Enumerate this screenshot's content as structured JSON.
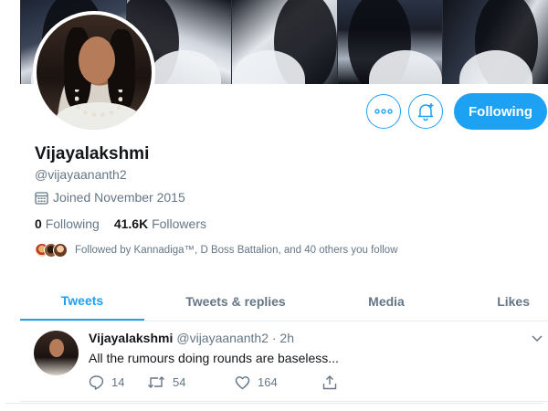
{
  "profile": {
    "name": "Vijayalakshmi",
    "handle": "@vijayaananth2",
    "joined": "Joined November 2015",
    "following_count": "0",
    "following_label": "Following",
    "followers_count": "41.6K",
    "followers_label": "Followers",
    "followed_by": "Followed by Kannadiga™, D Boss Battalion, and 40 others you follow"
  },
  "actions": {
    "follow_label": "Following",
    "more_icon": "more-icon",
    "notify_icon": "bell-plus-icon"
  },
  "tabs": [
    {
      "label": "Tweets",
      "active": true
    },
    {
      "label": "Tweets & replies",
      "active": false
    },
    {
      "label": "Media",
      "active": false
    },
    {
      "label": "Likes",
      "active": false
    }
  ],
  "tweet": {
    "name": "Vijayalakshmi",
    "meta": "@vijayaananth2 · 2h",
    "text": "All the rumours doing rounds are baseless...",
    "reply_count": "14",
    "retweet_count": "54",
    "like_count": "164"
  },
  "colors": {
    "accent": "#1da1f2",
    "text": "#14171a",
    "secondary": "#657786"
  }
}
